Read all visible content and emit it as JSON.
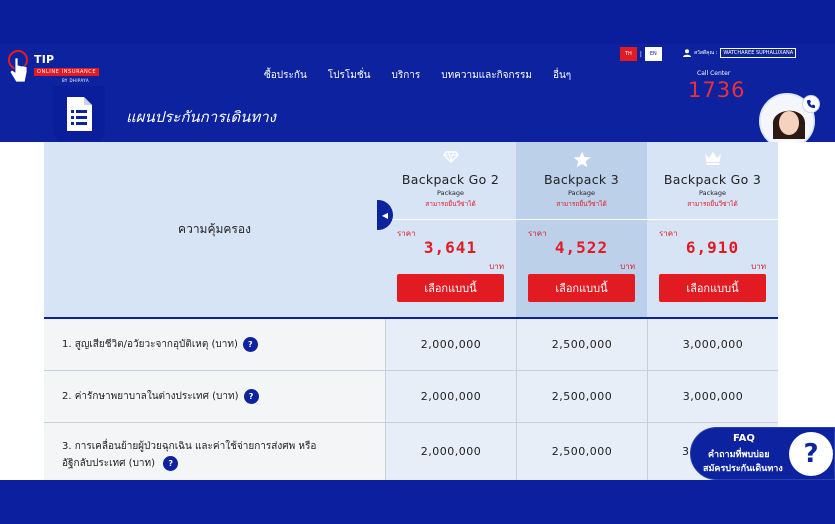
{
  "brand": {
    "title": "TIP INSURE",
    "subtitle": "ONLINE INSURANCE",
    "by": "BY DHIPAYA"
  },
  "nav": {
    "items": [
      "ซื้อประกัน",
      "โปรโมชั่น",
      "บริการ",
      "บทความและกิจกรรม",
      "อื่นๆ"
    ]
  },
  "lang": {
    "th": "TH",
    "en": "EN",
    "sep": "|"
  },
  "user": {
    "greeting": "สวัสดีคุณ :",
    "name": "WATCHAREE SUPHALUXANA"
  },
  "call_center": {
    "label": "Call Center",
    "number": "1736"
  },
  "page": {
    "title": "แผนประกันการเดินทาง"
  },
  "table": {
    "coverage_header": "ความคุ้มครอง",
    "plans": [
      {
        "icon": "diamond-icon",
        "name": "Backpack Go 2",
        "package": "Package",
        "visa": "สามารถยื่นวีซ่าได้",
        "price_label": "ราคา",
        "price": "3,641",
        "unit": "บาท",
        "button": "เลือกแบบนี้"
      },
      {
        "icon": "star-icon",
        "name": "Backpack 3",
        "package": "Package",
        "visa": "สามารถยื่นวีซ่าได้",
        "price_label": "ราคา",
        "price": "4,522",
        "unit": "บาท",
        "button": "เลือกแบบนี้"
      },
      {
        "icon": "crown-icon",
        "name": "Backpack Go 3",
        "package": "Package",
        "visa": "สามารถยื่นวีซ่าได้",
        "price_label": "ราคา",
        "price": "6,910",
        "unit": "บาท",
        "button": "เลือกแบบนี้"
      }
    ],
    "rows": [
      {
        "label": "1. สูญเสียชีวิต/อวัยวะจากอุบัติเหตุ (บาท)",
        "values": [
          "2,000,000",
          "2,500,000",
          "3,000,000"
        ]
      },
      {
        "label": "2. ค่ารักษาพยาบาลในต่างประเทศ (บาท)",
        "values": [
          "2,000,000",
          "2,500,000",
          "3,000,000"
        ]
      },
      {
        "label_line1": "3. การเคลื่อนย้ายผู้ป่วยฉุกเฉิน และค่าใช้จ่ายการส่งศพ หรือ",
        "label_line2": "อัฐิกลับประเทศ (บาท)",
        "values": [
          "2,000,000",
          "2,500,000",
          "3,"
        ]
      }
    ]
  },
  "faq": {
    "title": "FAQ",
    "line1": "คำถามที่พบบ่อย",
    "line2": "สมัครประกันเดินทาง",
    "icon_text": "?"
  },
  "colors": {
    "primary": "#0c229e",
    "accent": "#e21b23",
    "table_head": "#d7e4f6"
  }
}
